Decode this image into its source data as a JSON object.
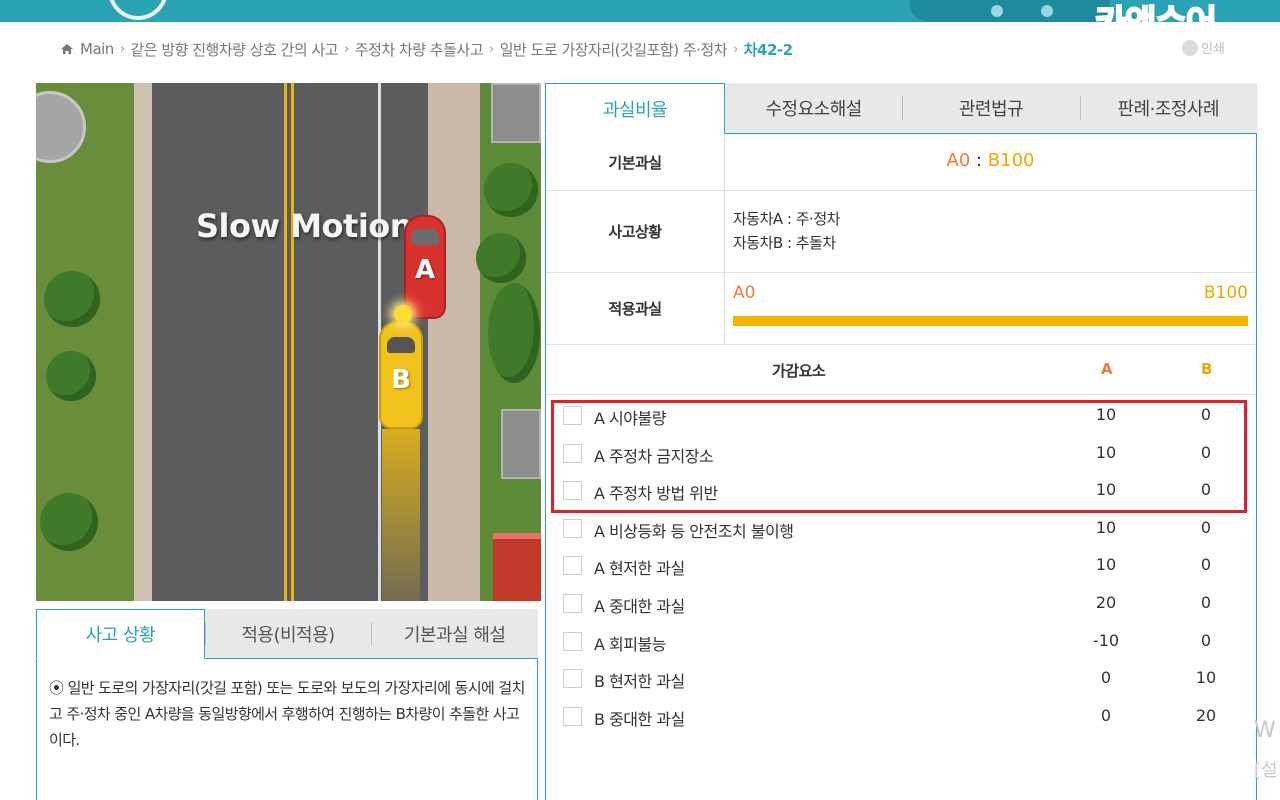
{
  "watermark": "카앤슈어",
  "breadcrumb": {
    "home": "Main",
    "items": [
      "같은 방향 진행차량 상호 간의 사고",
      "주정차 차량 추돌사고",
      "일반 도로 가장자리(갓길포함) 주·정차"
    ],
    "current": "차42-2"
  },
  "print_label": "인쇄",
  "video": {
    "overlay_text": "Slow Motion",
    "car_a_label": "A",
    "car_b_label": "B"
  },
  "left_tabs": [
    "사고 상황",
    "적용(비적용)",
    "기본과실 해설"
  ],
  "left_description": "⦿ 일반 도로의 가장자리(갓길 포함) 또는 도로와 보도의 가장자리에 동시에 걸치고 주·정차 중인 A차량을 동일방향에서 후행하여 진행하는 B차량이 추돌한 사고이다.",
  "right_tabs": [
    "과실비율",
    "수정요소해설",
    "관련법규",
    "판례·조정사례"
  ],
  "basic_fault": {
    "label": "기본과실",
    "a": "A0",
    "sep": " : ",
    "b": "B100"
  },
  "situation": {
    "label": "사고상황",
    "line1": "자동차A : 주·정차",
    "line2": "자동차B : 추돌차"
  },
  "applied_fault": {
    "label": "적용과실",
    "a": "A0",
    "b": "B100",
    "a_percent": 0
  },
  "factors_header": {
    "title": "가감요소",
    "a": "A",
    "b": "B"
  },
  "factors": [
    {
      "name": "A 시야불량",
      "a": "10",
      "b": "0"
    },
    {
      "name": "A 주정차 금지장소",
      "a": "10",
      "b": "0"
    },
    {
      "name": "A 주정차 방법 위반",
      "a": "10",
      "b": "0"
    },
    {
      "name": "A 비상등화 등 안전조치 불이행",
      "a": "10",
      "b": "0"
    },
    {
      "name": "A 현저한 과실",
      "a": "10",
      "b": "0"
    },
    {
      "name": "A 중대한 과실",
      "a": "20",
      "b": "0"
    },
    {
      "name": "A 회피불능",
      "a": "-10",
      "b": "0"
    },
    {
      "name": "B 현저한 과실",
      "a": "0",
      "b": "10"
    },
    {
      "name": "B 중대한 과실",
      "a": "0",
      "b": "20"
    }
  ],
  "edge_fragments": {
    "w": "W",
    "bracket": "[설"
  },
  "colors": {
    "accent": "#2aa3b5",
    "party_a": "#f07a3a",
    "party_b": "#f0a500",
    "highlight": "#e0202a"
  }
}
